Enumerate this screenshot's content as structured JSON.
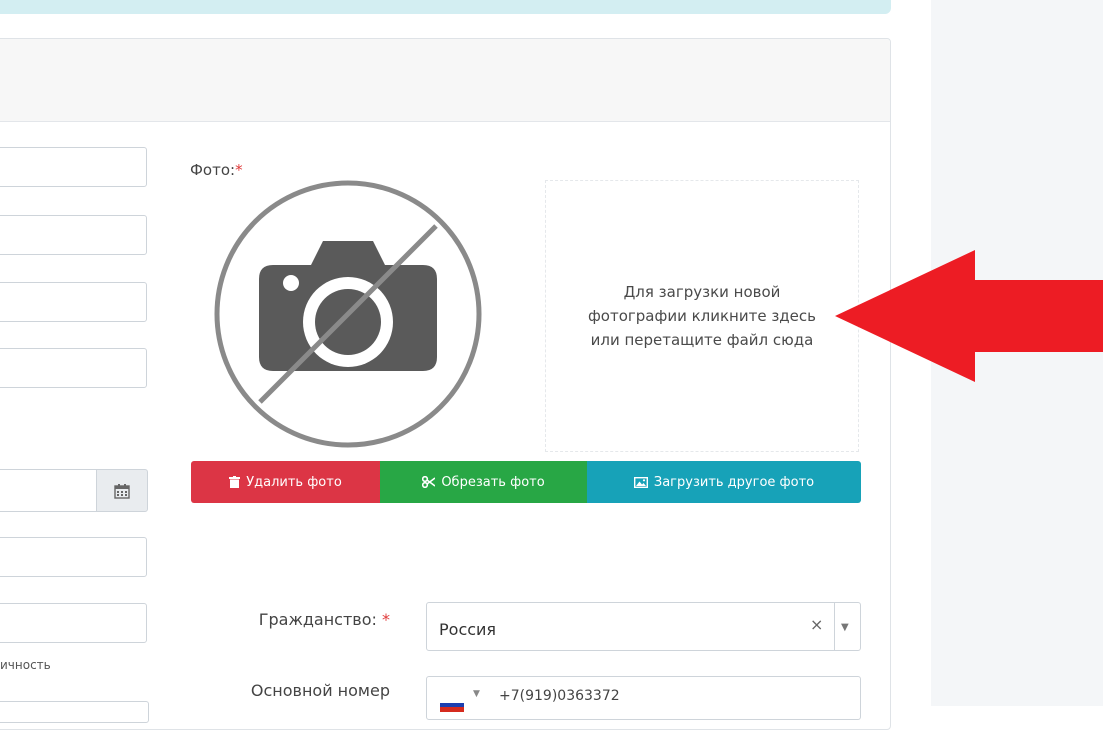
{
  "photo": {
    "label": "Фото:",
    "required_mark": "*",
    "dropzone_text": "Для загрузки новой\nфотографии кликните здесь\nили перетащите файл сюда",
    "no_photo_icon": "camera-slash-icon"
  },
  "buttons": {
    "delete": "Удалить фото",
    "crop": "Обрезать фото",
    "upload": "Загрузить другое фото"
  },
  "form": {
    "cut_label": "ичность",
    "citizenship_label": "Гражданство:",
    "citizenship_required": "*",
    "citizenship_value": "Россия",
    "clear_symbol": "×",
    "phone_label": "Основной номер",
    "phone_value": "+7(919)0363372"
  },
  "colors": {
    "delete": "#dc3545",
    "crop": "#28a745",
    "upload": "#17a2b8",
    "arrow": "#ed1c24"
  }
}
